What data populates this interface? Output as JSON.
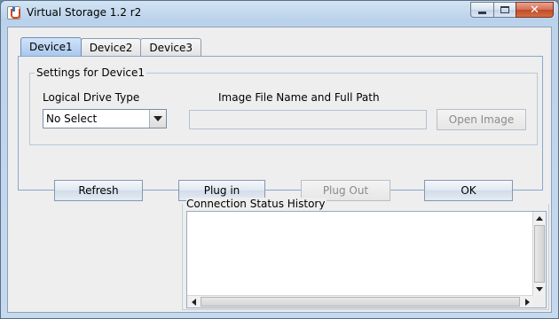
{
  "window": {
    "title": "Virtual Storage 1.2 r2",
    "close_glyph": "✕"
  },
  "tabs": [
    {
      "label": "Device1",
      "active": true
    },
    {
      "label": "Device2",
      "active": false
    },
    {
      "label": "Device3",
      "active": false
    }
  ],
  "settings": {
    "group_title": "Settings for Device1",
    "drive_type_label": "Logical Drive Type",
    "drive_type_value": "No Select",
    "image_path_label": "Image File Name and Full Path",
    "image_path_value": "",
    "open_image_label": "Open Image"
  },
  "actions": {
    "refresh": "Refresh",
    "plug_in": "Plug in",
    "plug_out": "Plug Out",
    "ok": "OK"
  },
  "history": {
    "title": "Connection Status History",
    "text": ""
  },
  "icons": {
    "app": "java-coffee-cup-icon",
    "minimize": "minimize-icon",
    "maximize": "maximize-icon",
    "close": "close-icon",
    "dropdown": "chevron-down-icon"
  },
  "colors": {
    "active_tab": "#b7d3f2",
    "close_button": "#c94a2c",
    "panel_bg": "#eeeeee"
  }
}
